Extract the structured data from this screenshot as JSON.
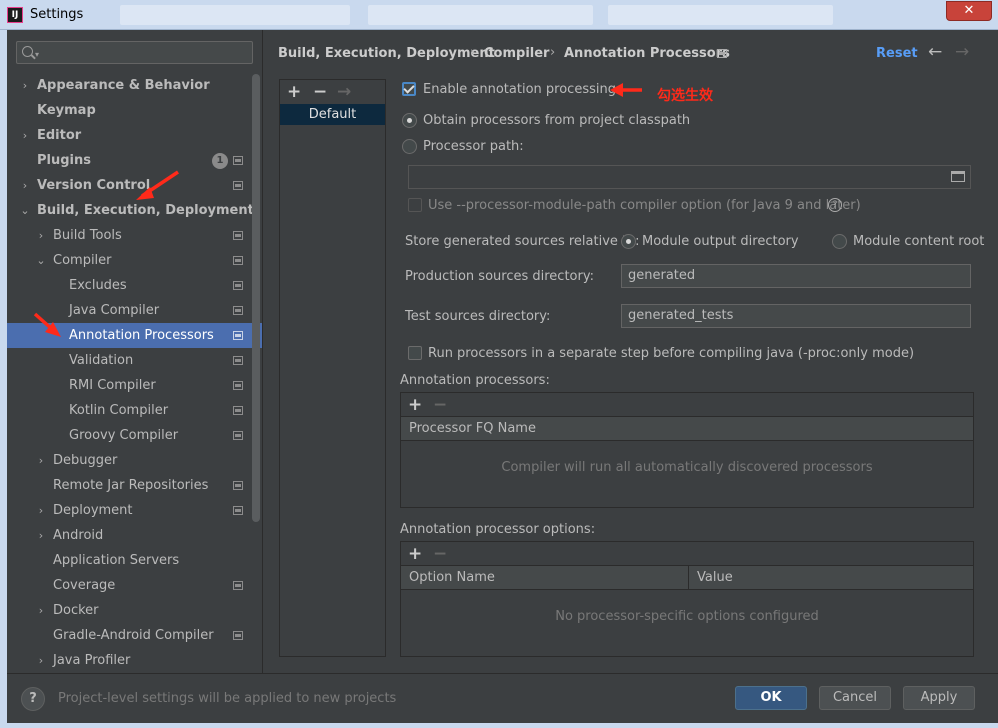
{
  "window": {
    "title": "Settings",
    "close_label": "✕",
    "app_icon_text": "IJ"
  },
  "sidebar": {
    "search_placeholder": "",
    "items": [
      {
        "label": "Appearance & Behavior"
      },
      {
        "label": "Keymap"
      },
      {
        "label": "Editor"
      },
      {
        "label": "Plugins",
        "badge": "1"
      },
      {
        "label": "Version Control"
      },
      {
        "label": "Build, Execution, Deployment"
      },
      {
        "label": "Build Tools"
      },
      {
        "label": "Compiler"
      },
      {
        "label": "Excludes"
      },
      {
        "label": "Java Compiler"
      },
      {
        "label": "Annotation Processors"
      },
      {
        "label": "Validation"
      },
      {
        "label": "RMI Compiler"
      },
      {
        "label": "Kotlin Compiler"
      },
      {
        "label": "Groovy Compiler"
      },
      {
        "label": "Debugger"
      },
      {
        "label": "Remote Jar Repositories"
      },
      {
        "label": "Deployment"
      },
      {
        "label": "Android"
      },
      {
        "label": "Application Servers"
      },
      {
        "label": "Coverage"
      },
      {
        "label": "Docker"
      },
      {
        "label": "Gradle-Android Compiler"
      },
      {
        "label": "Java Profiler"
      }
    ],
    "selected_index": 10
  },
  "header": {
    "breadcrumb": [
      "Build, Execution, Deployment",
      "Compiler",
      "Annotation Processors"
    ],
    "reset_label": "Reset"
  },
  "profiles": {
    "add": "+",
    "remove": "−",
    "move": "→",
    "items": [
      "Default"
    ]
  },
  "options": {
    "enable_label": "Enable annotation processing",
    "enable_checked": true,
    "obtain_classpath_label": "Obtain processors from project classpath",
    "processor_path_label": "Processor path:",
    "processor_path_value": "",
    "module_path_label": "Use --processor-module-path compiler option (for Java 9 and later)",
    "store_label": "Store generated sources relative to:",
    "module_output_label": "Module output directory",
    "module_content_label": "Module content root",
    "production_label": "Production sources directory:",
    "production_value": "generated",
    "test_label": "Test sources directory:",
    "test_value": "generated_tests",
    "separate_step_label": "Run processors in a separate step before compiling java (-proc:only mode)"
  },
  "processors_table": {
    "title": "Annotation processors:",
    "add": "+",
    "remove": "−",
    "columns": [
      "Processor FQ Name"
    ],
    "empty_text": "Compiler will run all automatically discovered processors"
  },
  "options_table": {
    "title": "Annotation processor options:",
    "add": "+",
    "remove": "−",
    "columns": [
      "Option Name",
      "Value"
    ],
    "empty_text": "No processor-specific options configured"
  },
  "annotation": {
    "text": "勾选生效",
    "color": "#ff2a1a"
  },
  "footer": {
    "help_label": "?",
    "note": "Project-level settings will be applied to new projects",
    "ok_label": "OK",
    "cancel_label": "Cancel",
    "apply_label": "Apply"
  },
  "colors": {
    "accent": "#4b6eaf",
    "link": "#589df6",
    "primary_button": "#365880",
    "background": "#3c3f41"
  }
}
